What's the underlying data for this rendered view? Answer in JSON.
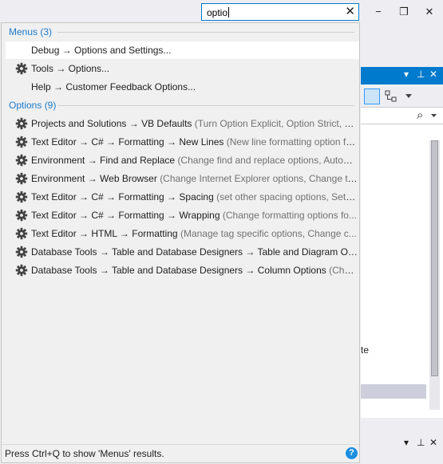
{
  "search": {
    "value": "optio",
    "clear_icon": "close-icon"
  },
  "window_controls": {
    "minimize": "−",
    "restore": "❐",
    "close": "✕"
  },
  "menus_group": {
    "header": "Menus (3)",
    "items": [
      {
        "label": "Debug → Options and Settings...",
        "icon": "none",
        "desc": ""
      },
      {
        "label": "Tools → Options...",
        "icon": "gear-icon",
        "desc": ""
      },
      {
        "label": "Help → Customer Feedback Options...",
        "icon": "none",
        "desc": ""
      }
    ]
  },
  "options_group": {
    "header": "Options (9)",
    "items": [
      {
        "label": "Projects and Solutions → VB Defaults",
        "desc": "(Turn Option Explicit, Option Strict, O..."
      },
      {
        "label": "Text Editor → C# → Formatting → New Lines",
        "desc": "(New line formatting option fo..."
      },
      {
        "label": "Environment → Find and Replace",
        "desc": "(Change find and replace options, Autom..."
      },
      {
        "label": "Environment → Web Browser",
        "desc": "(Change Internet Explorer options, Change th..."
      },
      {
        "label": "Text Editor → C# → Formatting → Spacing",
        "desc": "(set other spacing options, Set sp..."
      },
      {
        "label": "Text Editor → C# → Formatting → Wrapping",
        "desc": "(Change formatting options fo..."
      },
      {
        "label": "Text Editor → HTML → Formatting",
        "desc": "(Manage tag specific options, Change c..."
      },
      {
        "label": "Database Tools → Table and Database Designers → Table and Diagram Opti...",
        "desc": ""
      },
      {
        "label": "Database Tools → Table and Database Designers → Column Options",
        "desc": "(Chan..."
      }
    ]
  },
  "footer": {
    "text": "Press Ctrl+Q to show 'Menus' results.",
    "help_icon": "?"
  },
  "side_panel": {
    "title_pin": "▾",
    "title_pushpin": "⊥",
    "title_close": "✕",
    "search_icon": "⌕",
    "fragment_text": "te",
    "bottom_pin": "▾",
    "bottom_pushpin": "⊥",
    "bottom_close": "✕"
  },
  "colors": {
    "accent": "#007acc",
    "group_header": "#1c7bc9",
    "desc_text": "#717171"
  }
}
